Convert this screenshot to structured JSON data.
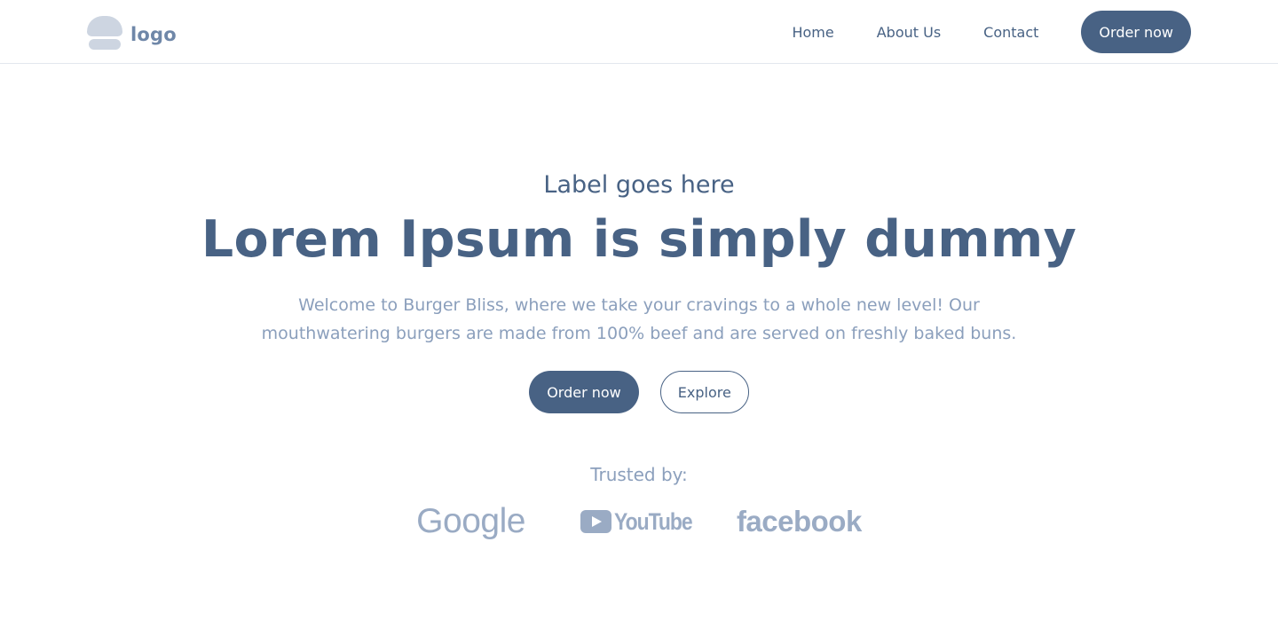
{
  "header": {
    "logo_text": "logo",
    "nav": [
      {
        "label": "Home"
      },
      {
        "label": "About Us"
      },
      {
        "label": "Contact"
      }
    ],
    "cta_label": "Order now"
  },
  "hero": {
    "eyebrow": "Label goes here",
    "headline": "Lorem Ipsum is simply dummy",
    "subtitle": "Welcome to Burger Bliss, where we take your cravings to a whole new level! Our mouthwatering burgers are made from 100% beef and are served on freshly baked buns.",
    "primary_label": "Order now",
    "secondary_label": "Explore"
  },
  "trusted": {
    "label": "Trusted by:",
    "brands": [
      "Google",
      "YouTube",
      "facebook"
    ]
  },
  "colors": {
    "primary": "#486284",
    "muted_text": "#8b9fbc",
    "logo_mark": "#cdd5e1",
    "brand_logos": "#9aabc4",
    "border": "#e3e7ee"
  },
  "icons": {
    "logo": "burger-logo-icon",
    "youtube": "youtube-play-icon"
  }
}
